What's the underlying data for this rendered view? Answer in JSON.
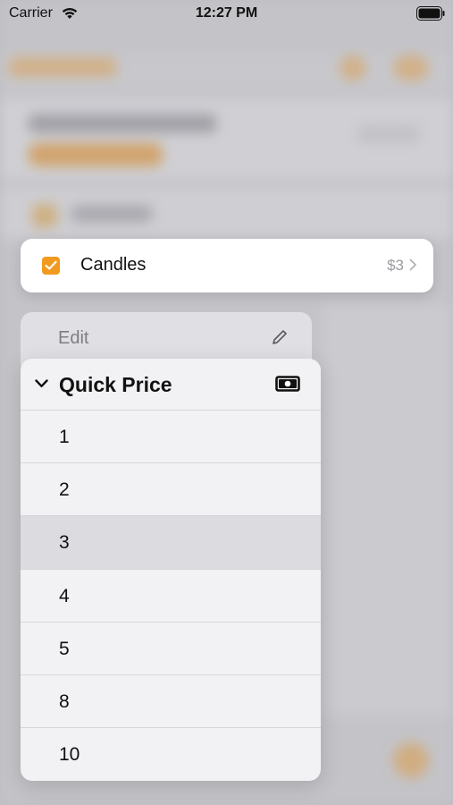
{
  "status_bar": {
    "carrier": "Carrier",
    "time": "12:27 PM",
    "icons": [
      "wifi-icon",
      "battery-icon"
    ]
  },
  "item": {
    "name": "Candles",
    "price": "$3",
    "checked": true,
    "check_color": "#f19a1f"
  },
  "edit_menu": {
    "label": "Edit",
    "icon": "pencil-icon"
  },
  "quick_price_menu": {
    "title": "Quick Price",
    "icon": "banknote-icon",
    "options": [
      {
        "label": "1",
        "highlighted": false
      },
      {
        "label": "2",
        "highlighted": false
      },
      {
        "label": "3",
        "highlighted": true
      },
      {
        "label": "4",
        "highlighted": false
      },
      {
        "label": "5",
        "highlighted": false
      },
      {
        "label": "8",
        "highlighted": false
      },
      {
        "label": "10",
        "highlighted": false
      }
    ]
  },
  "colors": {
    "accent": "#f19a1f",
    "menu_background": "#f2f2f4",
    "highlight": "#dcdce0"
  }
}
